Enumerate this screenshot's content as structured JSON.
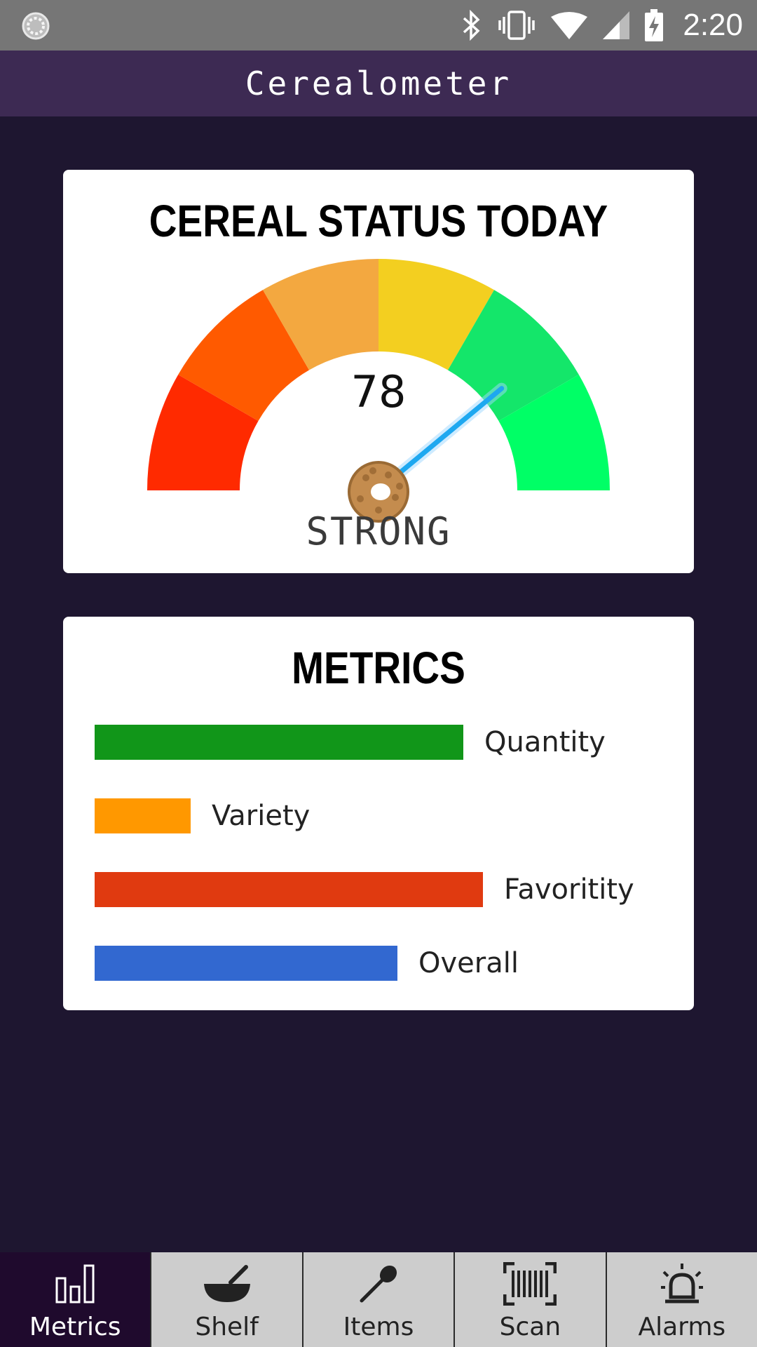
{
  "status_bar": {
    "time": "2:20",
    "icons": [
      "loading-spinner-icon",
      "bluetooth-icon",
      "vibrate-icon",
      "wifi-icon",
      "cell-signal-icon",
      "battery-charging-icon"
    ]
  },
  "app": {
    "title": "Cerealometer"
  },
  "gauge": {
    "title": "CEREAL STATUS TODAY",
    "value": 78,
    "value_text": "78",
    "min": 0,
    "max": 100,
    "status": "STRONG",
    "needle_color": "#1ea8f0",
    "segment_colors": [
      "#ff2a00",
      "#ff5a00",
      "#f3a840",
      "#f3cf20",
      "#14e66a",
      "#00ff66"
    ],
    "pivot_icon": "cereal-loop-icon"
  },
  "metrics": {
    "title": "METRICS",
    "items": [
      {
        "label": "Quantity",
        "value": 0.73,
        "color": "#119619"
      },
      {
        "label": "Variety",
        "value": 0.19,
        "color": "#ff9800"
      },
      {
        "label": "Favoritity",
        "value": 0.77,
        "color": "#e03a10"
      },
      {
        "label": "Overall",
        "value": 0.6,
        "color": "#3268d0"
      }
    ]
  },
  "nav": {
    "items": [
      {
        "label": "Metrics",
        "icon": "bar-chart-icon",
        "active": true
      },
      {
        "label": "Shelf",
        "icon": "bowl-icon",
        "active": false
      },
      {
        "label": "Items",
        "icon": "spoon-icon",
        "active": false
      },
      {
        "label": "Scan",
        "icon": "barcode-scan-icon",
        "active": false
      },
      {
        "label": "Alarms",
        "icon": "alarm-siren-icon",
        "active": false
      }
    ]
  }
}
